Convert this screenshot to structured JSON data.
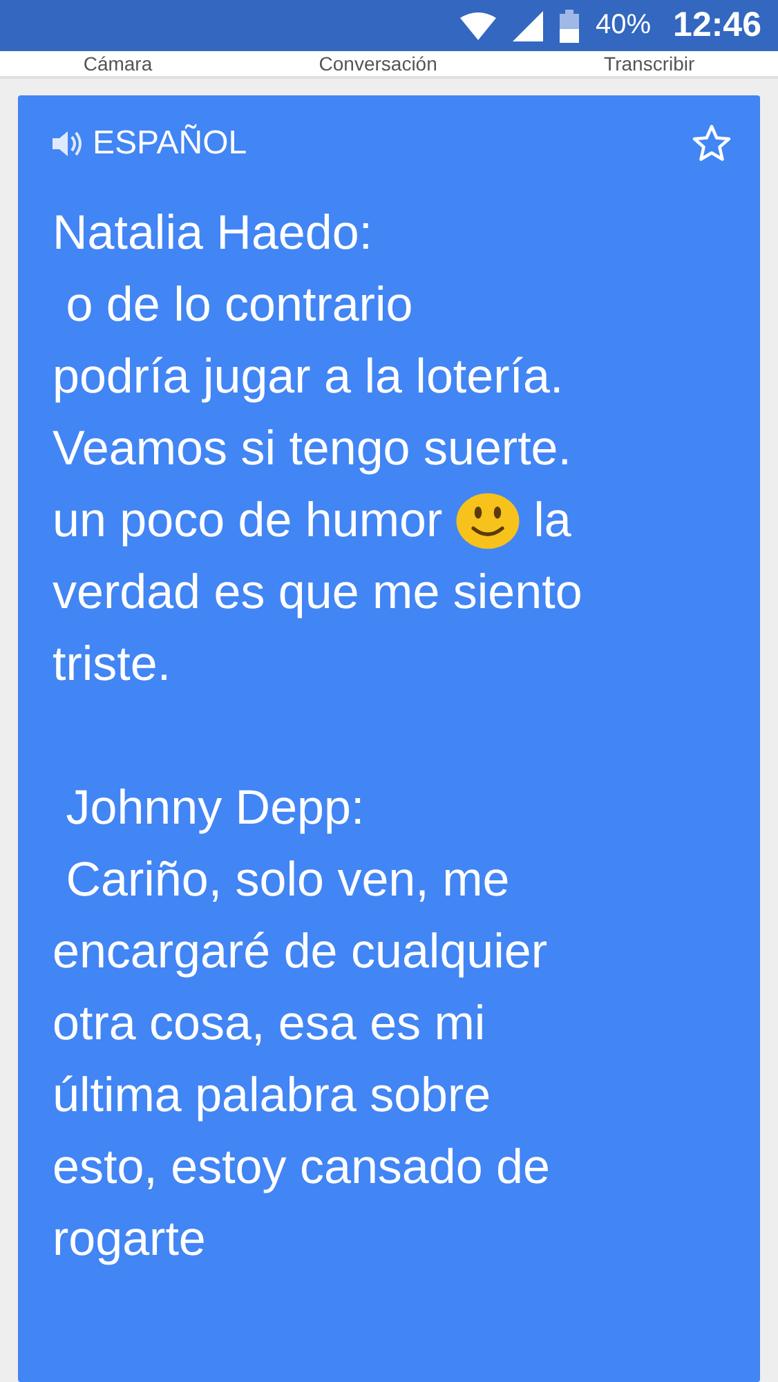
{
  "status_bar": {
    "battery": "40%",
    "time": "12:46"
  },
  "tabs": [
    {
      "label": "Cámara"
    },
    {
      "label": "Conversación"
    },
    {
      "label": "Transcribir"
    }
  ],
  "card": {
    "language": "ESPAÑOL",
    "starred": false,
    "lines": [
      {
        "kind": "text",
        "text": "Natalia Haedo:"
      },
      {
        "kind": "text",
        "text": " o de lo contrario"
      },
      {
        "kind": "text",
        "text": "podría jugar a la lotería."
      },
      {
        "kind": "text",
        "text": "Veamos si tengo suerte."
      },
      {
        "kind": "emoji",
        "before": "un poco de humor",
        "after": "la"
      },
      {
        "kind": "text",
        "text": "verdad es que me siento"
      },
      {
        "kind": "text",
        "text": "triste."
      },
      {
        "kind": "blank"
      },
      {
        "kind": "text",
        "text": " Johnny Depp:"
      },
      {
        "kind": "text",
        "text": " Cariño, solo ven, me"
      },
      {
        "kind": "text",
        "text": "encargaré de cualquier"
      },
      {
        "kind": "text",
        "text": "otra cosa, esa es mi"
      },
      {
        "kind": "text",
        "text": "última palabra sobre"
      },
      {
        "kind": "text",
        "text": "esto, estoy cansado de"
      },
      {
        "kind": "text",
        "text": "rogarte"
      }
    ]
  }
}
